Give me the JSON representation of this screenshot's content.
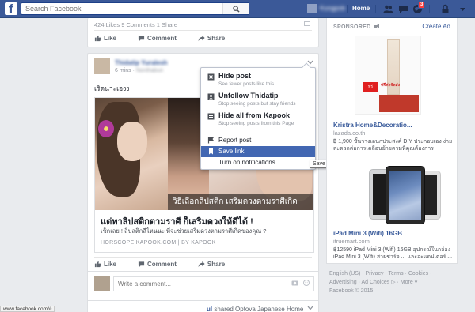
{
  "topbar": {
    "logo": "f",
    "search_placeholder": "Search Facebook",
    "user_name": "Kungpob",
    "home_label": "Home",
    "notification_count": "3"
  },
  "post1": {
    "stats": "424 Likes  9 Comments  1 Share",
    "actions": {
      "like": "Like",
      "comment": "Comment",
      "share": "Share"
    }
  },
  "post2": {
    "author": "Thidatip Yuralesh",
    "time": "6 mins",
    "location": "Nonthaburi",
    "text": "เริดน่าะเองง",
    "link": {
      "caption": "วิธีเลือกลิปสติก เสริมดวงตามราศีเกิด",
      "title": "แต่ทาลิปสติกตามราศี ก็เสริมดวงให้ดีได้ !",
      "description": "เช็กเลย ! ลิปสติกสีไหนนะ ที่จะช่วยเสริมดวงตามราศีเกิดของคุณ ?",
      "domain": "HORSCOPE.KAPOOK.COM | BY KAPOOK"
    },
    "actions": {
      "like": "Like",
      "comment": "Comment",
      "share": "Share"
    },
    "comment_placeholder": "Write a comment..."
  },
  "menu": {
    "items": [
      {
        "title": "Hide post",
        "sub": "See fewer posts like this"
      },
      {
        "title": "Unfollow Thidatip",
        "sub": "Stop seeing posts but stay friends"
      },
      {
        "title": "Hide all from Kapook",
        "sub": "Stop seeing posts from this Page"
      }
    ],
    "report": "Report post",
    "save": "Save link",
    "notifications": "Turn on notifications"
  },
  "tooltip": "Save link",
  "sidebar": {
    "sponsored": "SPONSORED",
    "create_ad": "Create Ad",
    "ad1": {
      "title": "Kristra Home&Decoratio...",
      "domain": "lazada.co.th",
      "description": "฿ 1,900 ชั้นวางเอนกประสงค์ DIY ประกอบเอง ง่าย สะดวกต่อการเคลื่อนย้ายตามที่คุณต้องการ",
      "badge": "ฟรี",
      "promo": "ฟรีค่าจัดส่ง"
    },
    "ad2": {
      "title": "iPad Mini 3 (Wifi) 16GB",
      "domain": "itruemart.com",
      "description": "฿12590 iPad Mini 3 (Wifi) 16GB อุปกรณ์ในกล่อง iPad Mini 3 (Wifi) สายชาร์จ ...",
      "description2": "และอะแดปเตอร์ ..."
    }
  },
  "footer": {
    "line1": "English (US) · Privacy · Terms · Cookies ·",
    "line2": "Advertising · Ad Choices ▷ · More ▾",
    "line3": "Facebook © 2015"
  },
  "status_url": "www.facebook.com/#",
  "next_post": {
    "prefix": "ul",
    "text": "shared Optova Japanese Home"
  }
}
